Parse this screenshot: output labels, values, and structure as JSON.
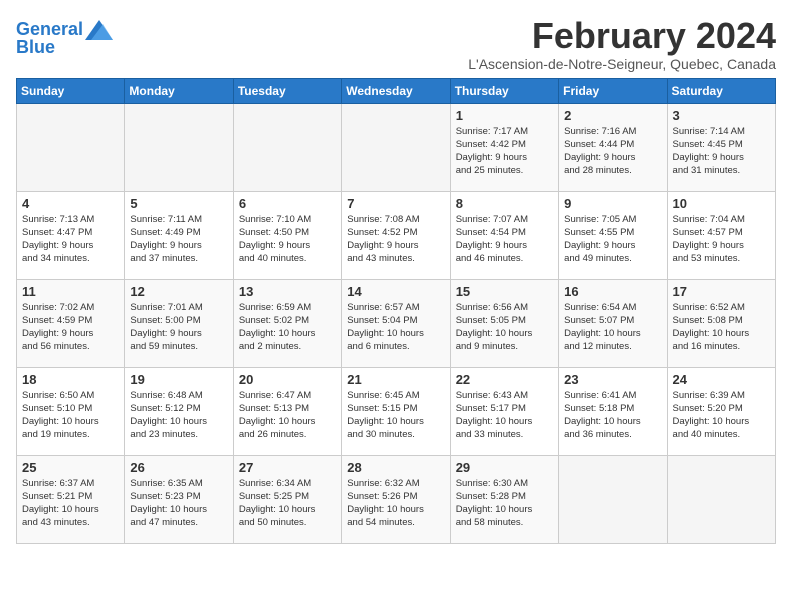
{
  "header": {
    "logo_line1": "General",
    "logo_line2": "Blue",
    "month": "February 2024",
    "location": "L'Ascension-de-Notre-Seigneur, Quebec, Canada"
  },
  "days_of_week": [
    "Sunday",
    "Monday",
    "Tuesday",
    "Wednesday",
    "Thursday",
    "Friday",
    "Saturday"
  ],
  "weeks": [
    [
      {
        "day": "",
        "info": ""
      },
      {
        "day": "",
        "info": ""
      },
      {
        "day": "",
        "info": ""
      },
      {
        "day": "",
        "info": ""
      },
      {
        "day": "1",
        "info": "Sunrise: 7:17 AM\nSunset: 4:42 PM\nDaylight: 9 hours\nand 25 minutes."
      },
      {
        "day": "2",
        "info": "Sunrise: 7:16 AM\nSunset: 4:44 PM\nDaylight: 9 hours\nand 28 minutes."
      },
      {
        "day": "3",
        "info": "Sunrise: 7:14 AM\nSunset: 4:45 PM\nDaylight: 9 hours\nand 31 minutes."
      }
    ],
    [
      {
        "day": "4",
        "info": "Sunrise: 7:13 AM\nSunset: 4:47 PM\nDaylight: 9 hours\nand 34 minutes."
      },
      {
        "day": "5",
        "info": "Sunrise: 7:11 AM\nSunset: 4:49 PM\nDaylight: 9 hours\nand 37 minutes."
      },
      {
        "day": "6",
        "info": "Sunrise: 7:10 AM\nSunset: 4:50 PM\nDaylight: 9 hours\nand 40 minutes."
      },
      {
        "day": "7",
        "info": "Sunrise: 7:08 AM\nSunset: 4:52 PM\nDaylight: 9 hours\nand 43 minutes."
      },
      {
        "day": "8",
        "info": "Sunrise: 7:07 AM\nSunset: 4:54 PM\nDaylight: 9 hours\nand 46 minutes."
      },
      {
        "day": "9",
        "info": "Sunrise: 7:05 AM\nSunset: 4:55 PM\nDaylight: 9 hours\nand 49 minutes."
      },
      {
        "day": "10",
        "info": "Sunrise: 7:04 AM\nSunset: 4:57 PM\nDaylight: 9 hours\nand 53 minutes."
      }
    ],
    [
      {
        "day": "11",
        "info": "Sunrise: 7:02 AM\nSunset: 4:59 PM\nDaylight: 9 hours\nand 56 minutes."
      },
      {
        "day": "12",
        "info": "Sunrise: 7:01 AM\nSunset: 5:00 PM\nDaylight: 9 hours\nand 59 minutes."
      },
      {
        "day": "13",
        "info": "Sunrise: 6:59 AM\nSunset: 5:02 PM\nDaylight: 10 hours\nand 2 minutes."
      },
      {
        "day": "14",
        "info": "Sunrise: 6:57 AM\nSunset: 5:04 PM\nDaylight: 10 hours\nand 6 minutes."
      },
      {
        "day": "15",
        "info": "Sunrise: 6:56 AM\nSunset: 5:05 PM\nDaylight: 10 hours\nand 9 minutes."
      },
      {
        "day": "16",
        "info": "Sunrise: 6:54 AM\nSunset: 5:07 PM\nDaylight: 10 hours\nand 12 minutes."
      },
      {
        "day": "17",
        "info": "Sunrise: 6:52 AM\nSunset: 5:08 PM\nDaylight: 10 hours\nand 16 minutes."
      }
    ],
    [
      {
        "day": "18",
        "info": "Sunrise: 6:50 AM\nSunset: 5:10 PM\nDaylight: 10 hours\nand 19 minutes."
      },
      {
        "day": "19",
        "info": "Sunrise: 6:48 AM\nSunset: 5:12 PM\nDaylight: 10 hours\nand 23 minutes."
      },
      {
        "day": "20",
        "info": "Sunrise: 6:47 AM\nSunset: 5:13 PM\nDaylight: 10 hours\nand 26 minutes."
      },
      {
        "day": "21",
        "info": "Sunrise: 6:45 AM\nSunset: 5:15 PM\nDaylight: 10 hours\nand 30 minutes."
      },
      {
        "day": "22",
        "info": "Sunrise: 6:43 AM\nSunset: 5:17 PM\nDaylight: 10 hours\nand 33 minutes."
      },
      {
        "day": "23",
        "info": "Sunrise: 6:41 AM\nSunset: 5:18 PM\nDaylight: 10 hours\nand 36 minutes."
      },
      {
        "day": "24",
        "info": "Sunrise: 6:39 AM\nSunset: 5:20 PM\nDaylight: 10 hours\nand 40 minutes."
      }
    ],
    [
      {
        "day": "25",
        "info": "Sunrise: 6:37 AM\nSunset: 5:21 PM\nDaylight: 10 hours\nand 43 minutes."
      },
      {
        "day": "26",
        "info": "Sunrise: 6:35 AM\nSunset: 5:23 PM\nDaylight: 10 hours\nand 47 minutes."
      },
      {
        "day": "27",
        "info": "Sunrise: 6:34 AM\nSunset: 5:25 PM\nDaylight: 10 hours\nand 50 minutes."
      },
      {
        "day": "28",
        "info": "Sunrise: 6:32 AM\nSunset: 5:26 PM\nDaylight: 10 hours\nand 54 minutes."
      },
      {
        "day": "29",
        "info": "Sunrise: 6:30 AM\nSunset: 5:28 PM\nDaylight: 10 hours\nand 58 minutes."
      },
      {
        "day": "",
        "info": ""
      },
      {
        "day": "",
        "info": ""
      }
    ]
  ]
}
